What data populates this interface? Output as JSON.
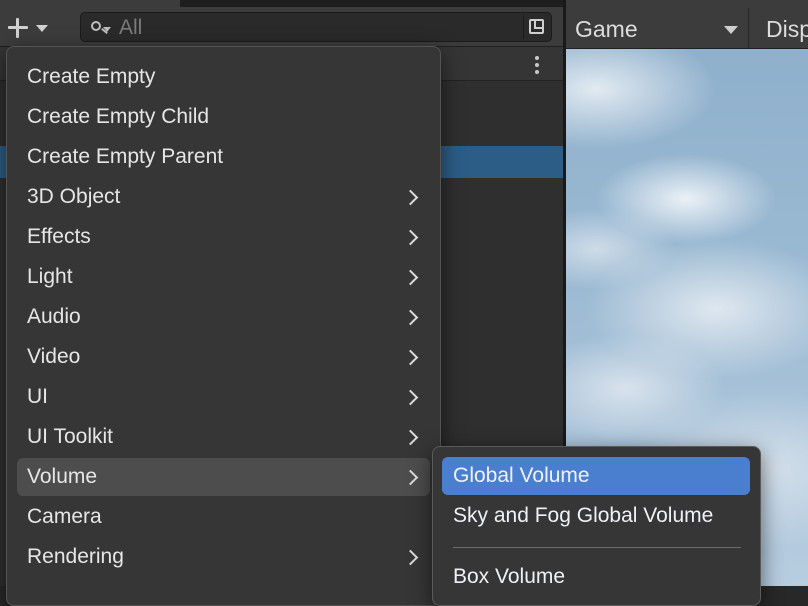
{
  "toolbar": {
    "add_icon": "plus-icon",
    "search": {
      "placeholder": "All",
      "value": ""
    }
  },
  "game_view": {
    "tab_label": "Game",
    "display_label": "Disp"
  },
  "context_menu": {
    "items": [
      {
        "label": "Create Empty",
        "submenu": false
      },
      {
        "label": "Create Empty Child",
        "submenu": false
      },
      {
        "label": "Create Empty Parent",
        "submenu": false
      },
      {
        "label": "3D Object",
        "submenu": true
      },
      {
        "label": "Effects",
        "submenu": true
      },
      {
        "label": "Light",
        "submenu": true
      },
      {
        "label": "Audio",
        "submenu": true
      },
      {
        "label": "Video",
        "submenu": true
      },
      {
        "label": "UI",
        "submenu": true
      },
      {
        "label": "UI Toolkit",
        "submenu": true
      },
      {
        "label": "Volume",
        "submenu": true,
        "active": true
      },
      {
        "label": "Camera",
        "submenu": false
      },
      {
        "label": "Rendering",
        "submenu": true
      }
    ]
  },
  "volume_submenu": {
    "items": [
      {
        "label": "Global Volume",
        "highlighted": true
      },
      {
        "label": "Sky and Fog Global Volume"
      },
      {
        "label": "Box Volume"
      }
    ]
  },
  "colors": {
    "highlight": "#4a7fd0",
    "hierarchy_selection": "#2c5d87",
    "menu_background": "#363636"
  }
}
